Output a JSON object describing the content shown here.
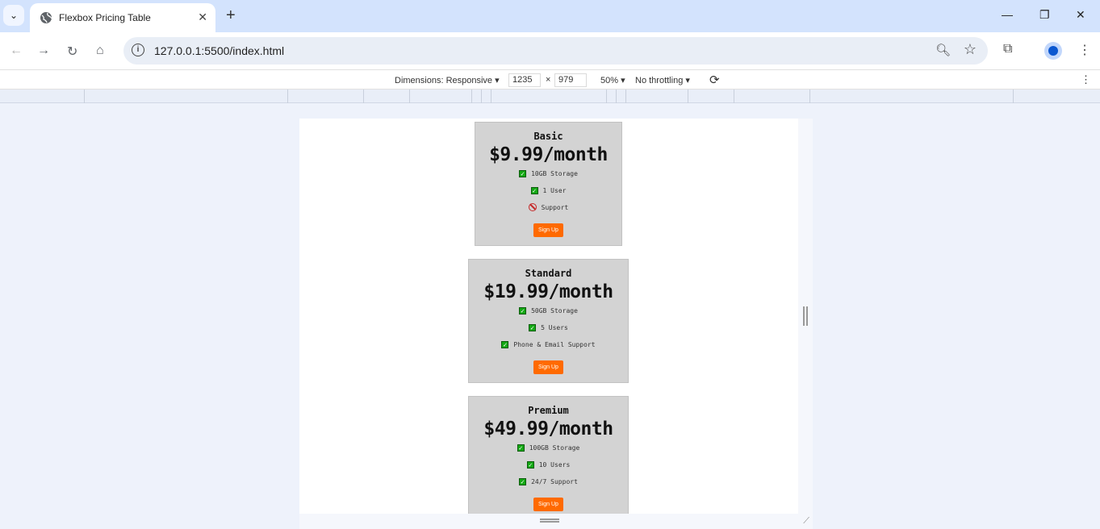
{
  "browser": {
    "tab_title": "Flexbox Pricing Table",
    "url": "127.0.0.1:5500/index.html"
  },
  "devtools": {
    "dimensions_label": "Dimensions: Responsive",
    "width": "1235",
    "height": "979",
    "times": "×",
    "zoom": "50%",
    "throttling": "No throttling"
  },
  "icons": {
    "tab_search": "chevron-down-icon",
    "tab": "globe-icon",
    "close": "close-icon",
    "new_tab": "plus-icon",
    "back": "arrow-left-icon",
    "forward": "arrow-right-icon",
    "reload": "reload-icon",
    "home": "home-icon",
    "site_info": "info-icon",
    "zoom": "magnifier-icon",
    "bookmark": "star-icon",
    "extensions": "puzzle-icon",
    "menu": "kebab-icon",
    "check": "check-icon",
    "unavailable": "prohibited-icon"
  },
  "colors": {
    "card_bg": "#d3d3d3",
    "signup_bg": "#ff6a00",
    "check": "#14a814",
    "prohibited": "#c62828"
  },
  "plans": [
    {
      "name": "Basic",
      "price": "$9.99/month",
      "features": [
        {
          "text": "10GB Storage",
          "included": true
        },
        {
          "text": "1 User",
          "included": true
        },
        {
          "text": "Support",
          "included": false
        }
      ],
      "button": "Sign Up"
    },
    {
      "name": "Standard",
      "price": "$19.99/month",
      "features": [
        {
          "text": "50GB Storage",
          "included": true
        },
        {
          "text": "5 Users",
          "included": true
        },
        {
          "text": "Phone & Email Support",
          "included": true
        }
      ],
      "button": "Sign Up"
    },
    {
      "name": "Premium",
      "price": "$49.99/month",
      "features": [
        {
          "text": "100GB Storage",
          "included": true
        },
        {
          "text": "10 Users",
          "included": true
        },
        {
          "text": "24/7 Support",
          "included": true
        }
      ],
      "button": "Sign Up"
    }
  ]
}
